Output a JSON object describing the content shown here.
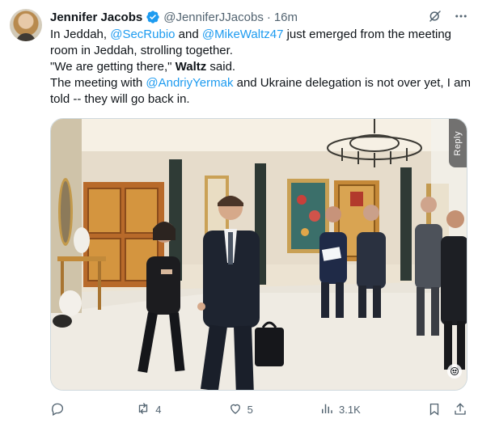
{
  "author": {
    "name": "Jennifer Jacobs",
    "handle": "@JenniferJJacobs",
    "separator": "·",
    "time": "16m"
  },
  "tweet": {
    "line1_prefix": "In Jeddah, ",
    "mention_rubio": "@SecRubio",
    "line1_mid": " and ",
    "mention_waltz": "@MikeWaltz47",
    "line1_suffix": " just emerged from the meeting room in Jeddah, strolling together.",
    "quote": "\"We are getting there,\" ",
    "quote_speaker": "Waltz",
    "quote_suffix": " said.",
    "line3_prefix": "The meeting with ",
    "mention_yermak": "@AndriyYermak",
    "line3_suffix": " and Ukraine delegation is not over yet, I am told -- they will go back in."
  },
  "media": {
    "reply_tab": "Reply"
  },
  "actions": {
    "reply_count": "",
    "repost_count": "4",
    "like_count": "5",
    "views_count": "3.1K"
  },
  "colors": {
    "accent": "#1d9bf0",
    "verified": "#1d9bf0",
    "muted": "#536471"
  }
}
